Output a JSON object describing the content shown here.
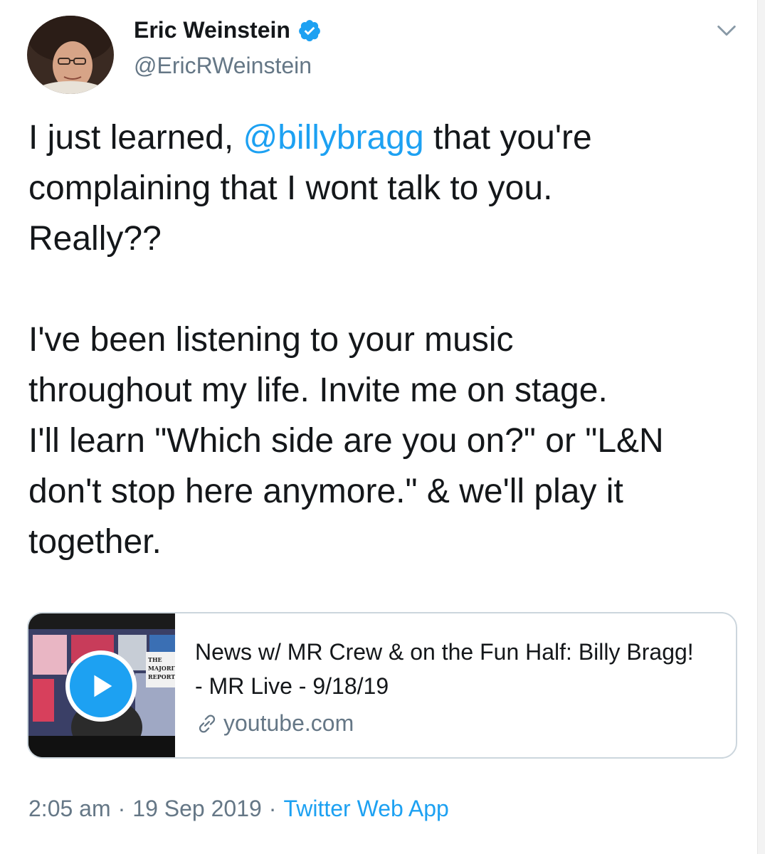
{
  "author": {
    "name": "Eric Weinstein",
    "handle": "@EricRWeinstein",
    "verified_icon": "verified-badge-icon",
    "menu_icon": "chevron-down-icon"
  },
  "tweet": {
    "text_before_mention": "I just learned, ",
    "mention": "@billybragg",
    "text_after_mention": " that you're\ncomplaining that I wont talk to you.\nReally??\n\nI've been listening to your music\nthroughout my life. Invite me on stage.\nI'll learn \"Which side are you on?\" or \"L&N\ndon't stop here anymore.\" & we'll play it\ntogether."
  },
  "card": {
    "thumbnail_text": "THE MAJORITY REPORT",
    "title": "News w/ MR Crew & on the Fun Half: Billy Bragg! - MR Live - 9/18/19",
    "domain": "youtube.com",
    "play_icon": "play-icon",
    "link_icon": "link-icon"
  },
  "meta": {
    "time": "2:05 am",
    "separator": "·",
    "date": "19 Sep 2019",
    "source": "Twitter Web App"
  },
  "colors": {
    "accent": "#1da1f2",
    "secondary_text": "#657786",
    "border": "#ccd6dd"
  }
}
